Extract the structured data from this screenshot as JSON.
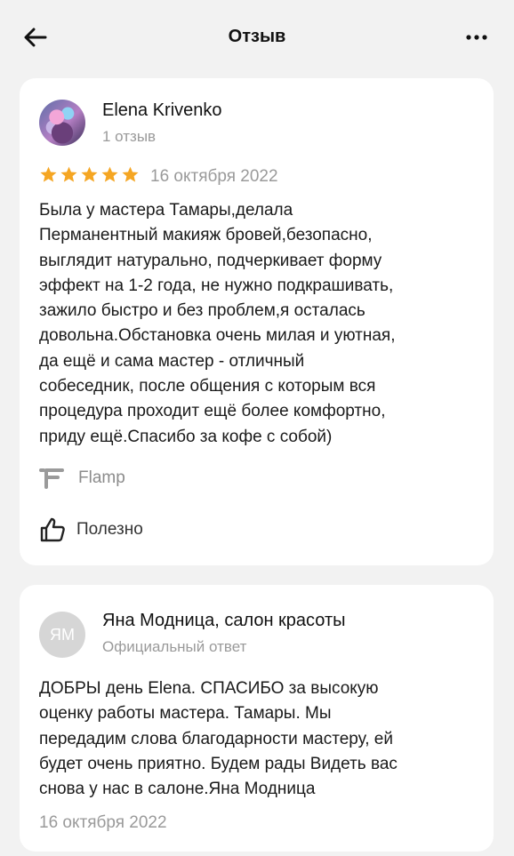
{
  "header": {
    "title": "Отзыв",
    "back_icon": "arrow-left-icon",
    "more_icon": "more-horizontal-icon"
  },
  "review": {
    "author": "Elena Krivenko",
    "reviews_count": "1 отзыв",
    "rating": 5,
    "max_rating": 5,
    "star_color": "#f5a623",
    "date": "16 октября 2022",
    "text": "Была у мастера Тамары,делала\nПерманентный макияж бровей,безопасно,\nвыглядит натурально, подчеркивает форму\nэффект на 1-2 года, не нужно подкрашивать,\nзажило быстро и без проблем,я осталась\nдовольна.Обстановка очень милая и уютная,\nда ещё и сама мастер - отличный\nсобеседник, после общения с которым вся\nпроцедура проходит ещё более комфортно,\nприду ещё.Спасибо за кофе с собой)",
    "source": "Flamp",
    "useful_label": "Полезно"
  },
  "reply": {
    "initials": "ЯМ",
    "name": "Яна Модница, салон красоты",
    "subtitle": "Официальный ответ",
    "text": "ДОБРЫ день Elena. СПАСИБО за высокую\nоценку работы мастера. Тамары. Мы\nпередадим слова благодарности мастеру, ей\nбудет очень приятно. Будем рады Видеть вас\nснова у нас в салоне.Яна Модница",
    "date": "16 октября 2022"
  }
}
